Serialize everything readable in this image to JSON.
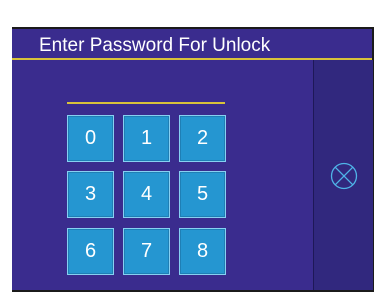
{
  "header": {
    "title": "Enter Password For Unlock"
  },
  "keypad": {
    "keys": [
      "0",
      "1",
      "2",
      "3",
      "4",
      "5",
      "6",
      "7",
      "8"
    ]
  },
  "colors": {
    "panel_background": "#3a2c8e",
    "accent_line": "#d8c23a",
    "key_fill": "#2596d1",
    "cancel_icon": "#4fb4e8"
  },
  "icons": {
    "cancel": "cancel-circle-x-icon"
  }
}
